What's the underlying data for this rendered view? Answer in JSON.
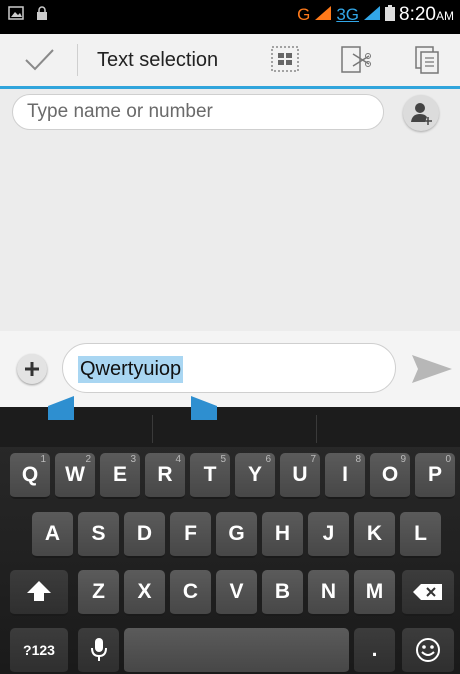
{
  "status_bar": {
    "network_g": "G",
    "network_3g": "3G",
    "time": "8:20",
    "ampm": "AM"
  },
  "action_bar": {
    "title": "Text selection",
    "icons": [
      "check-icon",
      "select-all-icon",
      "cut-icon",
      "copy-icon"
    ],
    "accent": "#31a5dc"
  },
  "recipient": {
    "placeholder": "Type name or number"
  },
  "message": {
    "selected_text": "Qwertyuiop",
    "selection_color": "#a9d6f2"
  },
  "keyboard": {
    "row1": [
      {
        "key": "Q",
        "hint": "1"
      },
      {
        "key": "W",
        "hint": "2"
      },
      {
        "key": "E",
        "hint": "3"
      },
      {
        "key": "R",
        "hint": "4"
      },
      {
        "key": "T",
        "hint": "5"
      },
      {
        "key": "Y",
        "hint": "6"
      },
      {
        "key": "U",
        "hint": "7"
      },
      {
        "key": "I",
        "hint": "8"
      },
      {
        "key": "O",
        "hint": "9"
      },
      {
        "key": "P",
        "hint": "0"
      }
    ],
    "row2": [
      "A",
      "S",
      "D",
      "F",
      "G",
      "H",
      "J",
      "K",
      "L"
    ],
    "row3": [
      "Z",
      "X",
      "C",
      "V",
      "B",
      "N",
      "M"
    ],
    "symbols_key": "?123",
    "period_key": "."
  }
}
